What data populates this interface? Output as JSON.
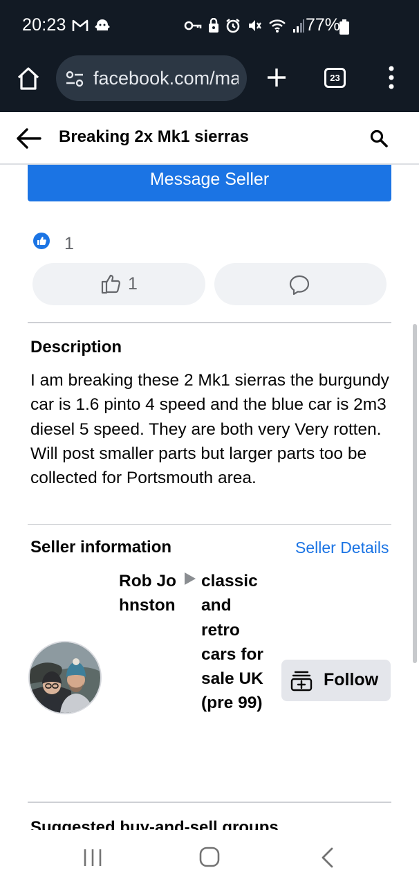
{
  "status_bar": {
    "time": "20:23",
    "battery": "77%",
    "left_icons": [
      "gmail-icon",
      "notification-icon"
    ],
    "right_icons": [
      "vpn-key-icon",
      "lock-icon",
      "alarm-icon",
      "mute-icon",
      "wifi-icon",
      "signal-icon"
    ]
  },
  "browser": {
    "url": "facebook.com/marketplace",
    "tab_count": "23"
  },
  "header": {
    "title": "Breaking 2x Mk1 sierras"
  },
  "listing": {
    "message_button": "Message Seller",
    "reaction_count": "1",
    "like_count": "1"
  },
  "description": {
    "heading": "Description",
    "body": "I am breaking these 2 Mk1 sierras the burgundy car is 1.6 pinto 4 speed and the blue car is 2m3 diesel 5 speed. They are both very Very rotten. Will post smaller parts but larger parts too be collected for Portsmouth area."
  },
  "seller": {
    "heading": "Seller information",
    "details_link": "Seller Details",
    "name": "Rob Johnston",
    "group": "classic and retro cars for sale UK (pre 99)",
    "follow_label": "Follow"
  },
  "suggested": {
    "heading": "Suggested buy-and-sell groups"
  },
  "colors": {
    "primary_blue": "#1b74e4",
    "status_bar_bg": "#121a24",
    "secondary_button_bg": "#f0f2f5"
  }
}
